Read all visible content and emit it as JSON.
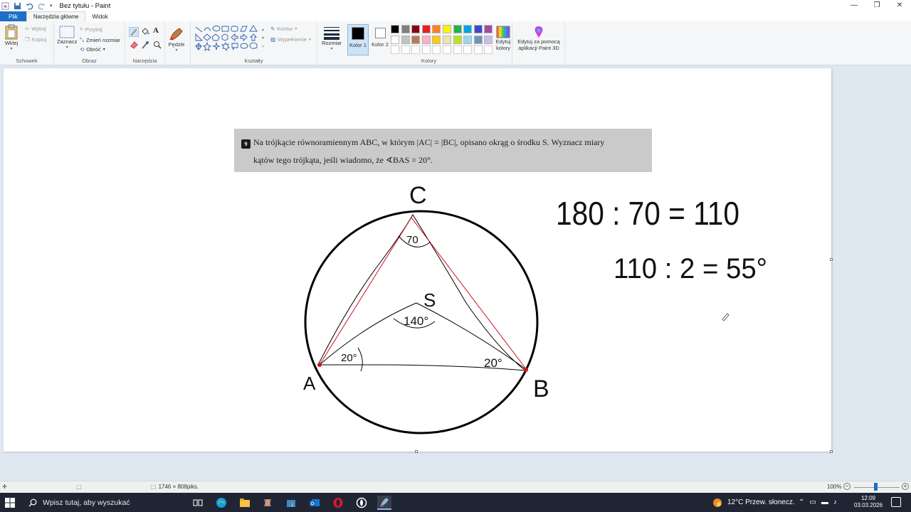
{
  "window": {
    "title": "Bez tytułu - Paint",
    "minimize": "—",
    "maximize": "❐",
    "close": "✕"
  },
  "tabs": [
    "Plik",
    "Narzędzia główne",
    "Widok"
  ],
  "ribbon": {
    "clipboard": {
      "paste": "Wklej",
      "cut": "Wytnij",
      "copy": "Kopiuj",
      "label": "Schowek"
    },
    "image": {
      "select": "Zaznacz",
      "crop": "Przytnij",
      "resize": "Zmień rozmiar",
      "rotate": "Obróć",
      "label": "Obraz"
    },
    "tools": {
      "label": "Narzędzia"
    },
    "brushes": {
      "label": "Pędzle"
    },
    "shapes": {
      "outline": "Kontur",
      "fill": "Wypełnienie",
      "label": "Kształty"
    },
    "size": {
      "label": "Rozmiar"
    },
    "colors": {
      "color1": "Kolor 1",
      "color2": "Kolor 2",
      "edit": "Edytuj kolory",
      "label": "Kolory",
      "color1_value": "#000000",
      "color2_value": "#ffffff",
      "palette_row1": [
        "#000000",
        "#7f7f7f",
        "#880015",
        "#ed1c24",
        "#ff7f27",
        "#fff200",
        "#22b14c",
        "#00a2e8",
        "#3f48cc",
        "#a349a4"
      ],
      "palette_row2": [
        "#ffffff",
        "#c3c3c3",
        "#b97a57",
        "#ffaec9",
        "#ffc90e",
        "#efe4b0",
        "#b5e61d",
        "#99d9ea",
        "#7092be",
        "#c8bfe7"
      ]
    },
    "paint3d": {
      "label": "Edytuj za pomocą aplikacji Paint 3D"
    }
  },
  "canvas": {
    "task_number": "9",
    "task_line1": "Na trójkącie równoramiennym ABC, w którym |AC| = |BC|, opisano okrąg o środku S. Wyznacz miary",
    "task_line2": "kątów tego trójkąta, jeśli wiadomo, że ∢BAS = 20°.",
    "handwriting": {
      "label_c": "C",
      "label_a": "A",
      "label_b": "B",
      "label_s": "S",
      "angle_c": "70",
      "angle_s": "140°",
      "angle_a": "20°",
      "angle_b": "20°",
      "calc1": "180 : 70 = 110",
      "calc2": "110 : 2 = 55°"
    }
  },
  "status": {
    "dimensions": "1746 × 808piks.",
    "zoom": "100%"
  },
  "taskbar": {
    "search_placeholder": "Wpisz tutaj, aby wyszukać",
    "weather": "12°C  Przew. słonecz.",
    "time": "12:09",
    "date": "03.03.2026"
  }
}
